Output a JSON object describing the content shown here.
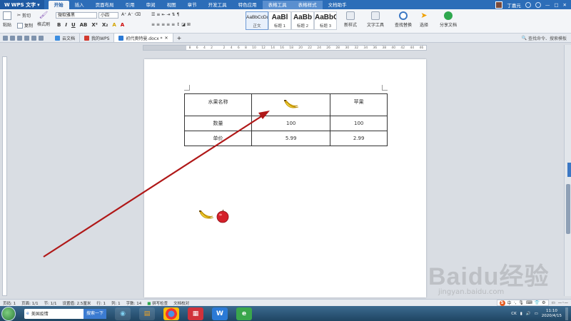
{
  "app": {
    "name": "WPS 文字"
  },
  "menu": [
    {
      "label": "开始",
      "active": true
    },
    {
      "label": "插入"
    },
    {
      "label": "页面布局"
    },
    {
      "label": "引用"
    },
    {
      "label": "审阅"
    },
    {
      "label": "视图"
    },
    {
      "label": "章节"
    },
    {
      "label": "开发工具"
    },
    {
      "label": "特色应用"
    },
    {
      "label": "表格工具",
      "tool": true
    },
    {
      "label": "表格样式",
      "tool": true
    },
    {
      "label": "文档助手"
    }
  ],
  "user": {
    "name": "丁嘉元"
  },
  "ribbon": {
    "paste": "粘贴",
    "cut": "剪切",
    "copy": "复制",
    "format_painter": "格式刷",
    "font_name": "微软雅黑",
    "font_size": "小四",
    "styles": [
      {
        "sample": "AaBbCcDd",
        "name": "正文"
      },
      {
        "sample": "AaBl",
        "name": "标题 1"
      },
      {
        "sample": "AaBb",
        "name": "标题 2"
      },
      {
        "sample": "AaBbC",
        "name": "标题 3"
      }
    ],
    "new_style": "新样式",
    "text_tools": "文字工具",
    "find_replace": "查找替换",
    "select": "选择",
    "share": "分享文档"
  },
  "tabs": [
    {
      "label": "云文档"
    },
    {
      "label": "我的WPS"
    },
    {
      "label": "初代奥特曼.docx *",
      "active": true
    }
  ],
  "command_search": "查找命令、搜索模板",
  "ruler_ticks": [
    "8",
    "6",
    "4",
    "2",
    "",
    "2",
    "4",
    "6",
    "8",
    "10",
    "12",
    "14",
    "16",
    "18",
    "20",
    "22",
    "24",
    "26",
    "28",
    "30",
    "32",
    "34",
    "36",
    "38",
    "40",
    "42",
    "44",
    "46"
  ],
  "table": {
    "header_label": "水果名称",
    "header_col3": "苹果",
    "rows": [
      {
        "label": "数量",
        "c2": "100",
        "c3": "100"
      },
      {
        "label": "单价",
        "c2": "5.99",
        "c3": "2.99"
      }
    ]
  },
  "arrow_color": "#b01818",
  "status": {
    "page": "页码: 1",
    "pages": "页面: 1/1",
    "section": "节: 1/1",
    "position": "设置值: 2.5厘米",
    "row": "行: 1",
    "col": "列: 1",
    "words": "字数: 14",
    "spell": "拼写检查",
    "doc_check": "文档校对"
  },
  "ime": {
    "mode": "中"
  },
  "taskbar": {
    "search_text": "美国疫情",
    "search_button": "搜索一下",
    "time": "11:10",
    "date": "2020/4/15",
    "tray_text": "CK"
  },
  "watermark": {
    "brand": "Baidu经验",
    "url": "jingyan.baidu.com"
  }
}
